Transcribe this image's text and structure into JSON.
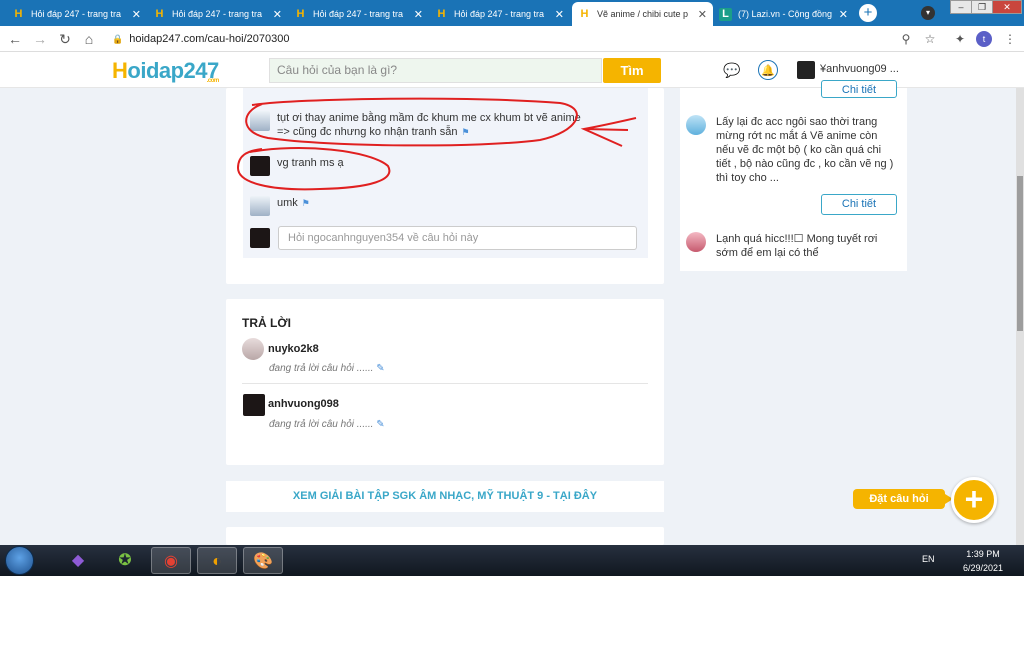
{
  "browser": {
    "tabs": [
      {
        "title": "Hỏi đáp 247 - trang tra",
        "icon": "hoidap-favicon"
      },
      {
        "title": "Hỏi đáp 247 - trang tra",
        "icon": "hoidap-favicon"
      },
      {
        "title": "Hỏi đáp 247 - trang tra",
        "icon": "hoidap-favicon"
      },
      {
        "title": "Hỏi đáp 247 - trang tra",
        "icon": "hoidap-favicon"
      },
      {
        "title": "Vẽ anime / chibi cute p",
        "icon": "hoidap-favicon",
        "active": true
      },
      {
        "title": "(7) Lazi.vn - Cộng đồng",
        "icon": "lazi-favicon"
      }
    ],
    "tab_close": "✕",
    "url": "hoidap247.com/cau-hoi/2070300",
    "profile_initial": "t"
  },
  "site": {
    "logo_h": "H",
    "logo_rest": "oidap247",
    "logo_com": ".com",
    "search_placeholder": "Câu hỏi của bạn là gì?",
    "search_button": "Tìm",
    "username": "¥anhvuong09 ..."
  },
  "comments": [
    {
      "text_line1": "tụt ơi thay anime bằng mầm đc khum me cx khum bt vẽ anime",
      "text_line2": "=> cũng đc nhưng ko nhận tranh sẵn",
      "avatar": "blue"
    },
    {
      "text_line1": "vg tranh ms ạ",
      "avatar": "dark"
    },
    {
      "text_line1": "umk",
      "avatar": "blue"
    }
  ],
  "comment_input_placeholder": "Hỏi ngocanhnguyen354 về câu hỏi này",
  "sidebar": {
    "item1": "Lấy lại đc acc ngôi sao thời trang mừng rớt nc mắt á Vẽ anime còn nếu vẽ đc một bộ ( ko cần quá chi tiết , bộ nào cũng đc , ko cần vẽ ng ) thì toy cho ...",
    "item2": "Lạnh quá hicc!!!☐ Mong tuyết rơi sớm để em lại có thể",
    "detail_button": "Chi tiết"
  },
  "answers": {
    "title": "TRẢ LỜI",
    "items": [
      {
        "name": "nuyko2k8",
        "status": "đang trả lời câu hỏi ......"
      },
      {
        "name": "anhvuong098",
        "status": "đang trả lời câu hỏi ......"
      }
    ]
  },
  "sgk_link": "XEM GIẢI BÀI TẬP SGK ÂM NHẠC, MỸ THUẬT 9 - TẠI ĐÂY",
  "ask_button": "Đặt câu hỏi",
  "taskbar": {
    "lang": "EN",
    "time": "1:39 PM",
    "date": "6/29/2021"
  },
  "colors": {
    "brand_yellow": "#f5b400",
    "brand_blue": "#3aa7c8",
    "chrome_blue": "#1a73b6",
    "annotation_red": "#e02020"
  }
}
